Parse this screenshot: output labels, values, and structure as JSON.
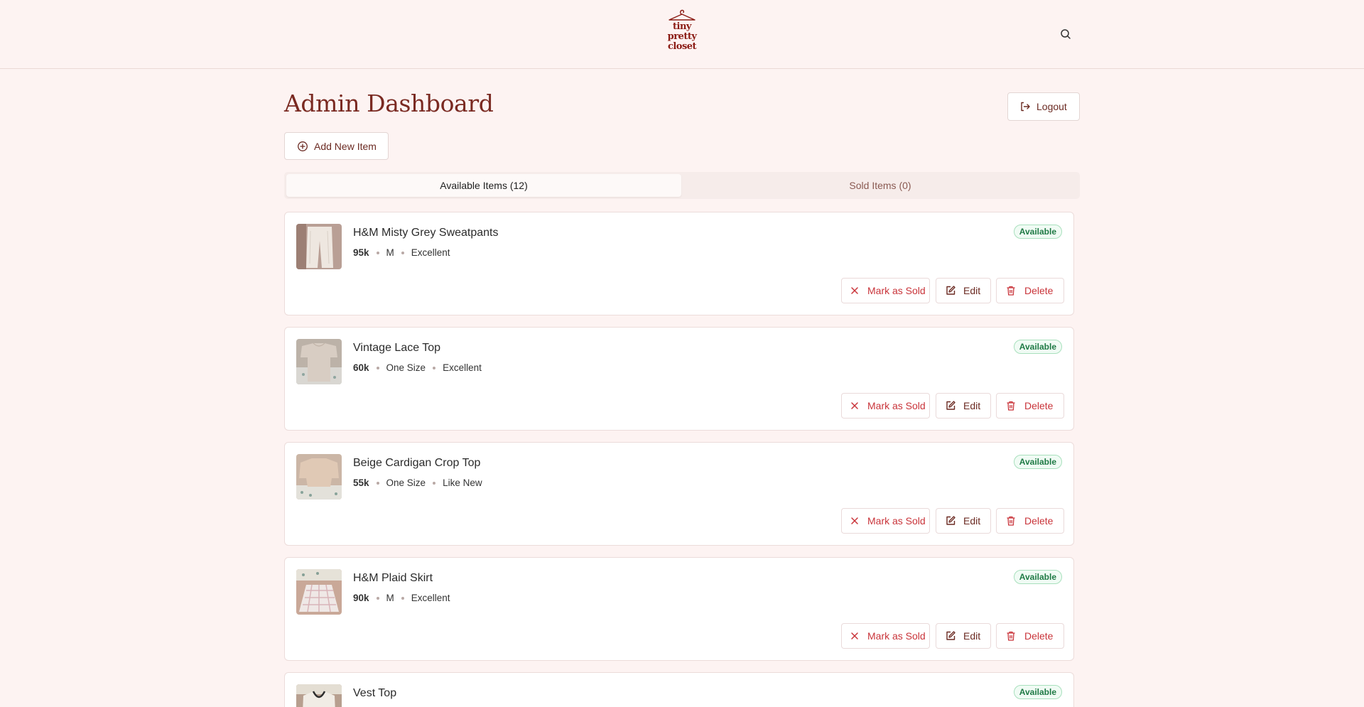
{
  "brand": {
    "logo_lines": [
      "tiny",
      "pretty",
      "closet"
    ]
  },
  "header": {
    "search_icon": "search-icon"
  },
  "page": {
    "title": "Admin Dashboard",
    "logout_label": "Logout",
    "add_item_label": "Add New Item"
  },
  "tabs": [
    {
      "label": "Available Items (12)",
      "active": true
    },
    {
      "label": "Sold Items (0)",
      "active": false
    }
  ],
  "items": [
    {
      "name": "H&M Misty Grey Sweatpants",
      "price": "95k",
      "size": "M",
      "condition": "Excellent",
      "status": "Available"
    },
    {
      "name": "Vintage Lace Top",
      "price": "60k",
      "size": "One Size",
      "condition": "Excellent",
      "status": "Available"
    },
    {
      "name": "Beige Cardigan Crop Top",
      "price": "55k",
      "size": "One Size",
      "condition": "Like New",
      "status": "Available"
    },
    {
      "name": "H&M Plaid Skirt",
      "price": "90k",
      "size": "M",
      "condition": "Excellent",
      "status": "Available"
    },
    {
      "name": "Vest Top",
      "price": "",
      "size": "",
      "condition": "",
      "status": "Available"
    }
  ],
  "actions": {
    "mark_sold": "Mark as Sold",
    "edit": "Edit",
    "delete": "Delete"
  },
  "colors": {
    "accent": "#7a2a22",
    "danger": "#c9343a",
    "success": "#1f7a45",
    "background": "#fdf3f2"
  }
}
